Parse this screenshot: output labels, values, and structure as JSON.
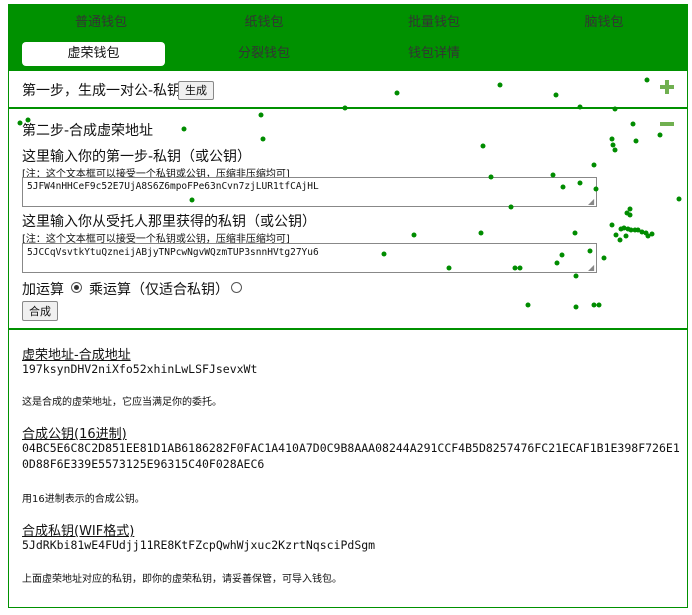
{
  "tabs": [
    {
      "label": "普通钱包",
      "active": false
    },
    {
      "label": "纸钱包",
      "active": false
    },
    {
      "label": "批量钱包",
      "active": false
    },
    {
      "label": "脑钱包",
      "active": false
    },
    {
      "label": "虚荣钱包",
      "active": true
    },
    {
      "label": "分裂钱包",
      "active": false
    },
    {
      "label": "钱包详情",
      "active": false
    }
  ],
  "step1": {
    "label": "第一步，生成一对公-私钥",
    "generate_button": "生成"
  },
  "step2": {
    "title": "第二步-合成虚荣地址",
    "input1_label": "这里输入你的第一步-私钥（或公钥）",
    "input1_note": "[注：这个文本框可以接受一个私钥或公钥，压缩非压缩均可]",
    "input1_value": "5JFW4nHHCeF9c52E7UjA8S6Z6mpoFPe63nCvn7zjLUR1tfCAjHL",
    "input2_label": "这里输入你从受托人那里获得的私钥（或公钥）",
    "input2_note": "[注：这个文本框可以接受一个私钥或公钥，压缩非压缩均可]",
    "input2_value": "5JCCqVsvtkYtuQzneijABjyTNPcwNgvWQzmTUP3snnHVtg27Yu6",
    "op_add_label": "加运算",
    "op_mul_label": "乘运算（仅适合私钥）",
    "op_selected": "add",
    "combine_button": "合成"
  },
  "result": {
    "address_heading": "虚荣地址-合成地址",
    "address_value": "197ksynDHV2niXfo52xhinLwLSFJsevxWt",
    "address_note": "这是合成的虚荣地址，它应当满足你的委托。",
    "pubkey_heading": "合成公钥(16进制)",
    "pubkey_value": "04BC5E6C8C2D851EE81D1AB6186282F0FAC1A410A7D0C9B8AAA08244A291CCF4B5D8257476FC21ECAF1B1E398F726E10D88F6E339E5573125E96315C40F028AEC6",
    "pubkey_note": "用16进制表示的合成公钥。",
    "privkey_heading": "合成私钥(WIF格式)",
    "privkey_value": "5JdRKbi81wE4FUdjj11RE8KtFZcpQwhWjxuc2KzrtNqsciPdSgm",
    "privkey_note": "上面虚荣地址对应的私钥，即你的虚荣私钥，请妥善保管，可导入钱包。"
  },
  "colors": {
    "accent": "#009100",
    "dot": "#008c00",
    "plus_minus": "#70b050"
  },
  "icons": [
    "plus-icon",
    "minus-icon",
    "resize-grip-icon",
    "radio-icon"
  ]
}
